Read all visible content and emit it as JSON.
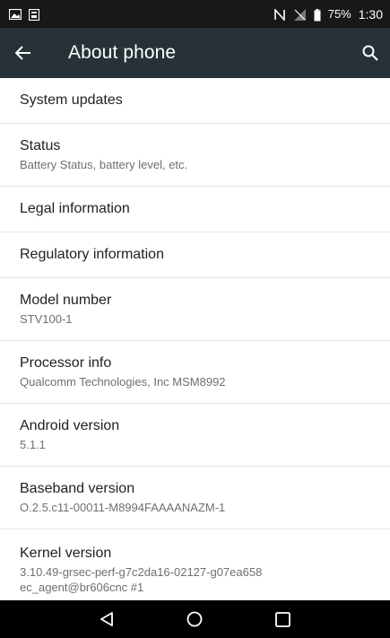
{
  "status_bar": {
    "battery": "75%",
    "time": "1:30",
    "icons": [
      "image-notification-icon",
      "download-notification-icon",
      "nfc-icon",
      "no-signal-icon",
      "battery-icon"
    ]
  },
  "app_bar": {
    "title": "About phone",
    "back_icon": "arrow-back-icon",
    "search_icon": "search-icon"
  },
  "settings": [
    {
      "title": "System updates"
    },
    {
      "title": "Status",
      "summary": "Battery Status, battery level, etc."
    },
    {
      "title": "Legal information"
    },
    {
      "title": "Regulatory information"
    },
    {
      "title": "Model number",
      "summary": "STV100-1"
    },
    {
      "title": "Processor info",
      "summary": "Qualcomm Technologies, Inc MSM8992"
    },
    {
      "title": "Android version",
      "summary": "5.1.1"
    },
    {
      "title": "Baseband version",
      "summary": "O.2.5.c11-00011-M8994FAAAANAZM-1"
    },
    {
      "title": "Kernel version",
      "summary": "3.10.49-grsec-perf-g7c2da16-02127-g07ea658",
      "summary2": "ec_agent@br606cnc #1"
    }
  ],
  "nav_bar": {
    "back_icon": "nav-back-icon",
    "home_icon": "nav-home-icon",
    "recents_icon": "nav-recents-icon"
  },
  "colors": {
    "status_bar": "#181818",
    "app_bar": "#263238",
    "title_text": "#212121",
    "summary_text": "#6f6f6f",
    "divider": "#e4e4e4"
  }
}
